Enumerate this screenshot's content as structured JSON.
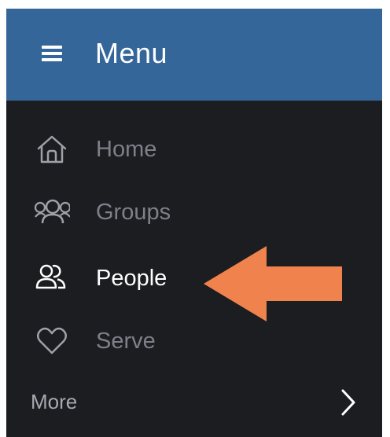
{
  "header": {
    "title": "Menu",
    "icon": "hamburger-icon",
    "background_color": "#35669a"
  },
  "nav": {
    "items": [
      {
        "label": "Home",
        "icon": "home-icon",
        "active": false
      },
      {
        "label": "Groups",
        "icon": "groups-icon",
        "active": false
      },
      {
        "label": "People",
        "icon": "people-icon",
        "active": true
      },
      {
        "label": "Serve",
        "icon": "heart-icon",
        "active": false
      }
    ],
    "more": {
      "label": "More",
      "icon": "chevron-right-icon"
    },
    "background_color": "#1c1d21",
    "inactive_text_color": "#7d8089",
    "active_text_color": "#ffffff"
  },
  "annotation": {
    "icon": "arrow-left-icon",
    "color": "#f0824e"
  }
}
